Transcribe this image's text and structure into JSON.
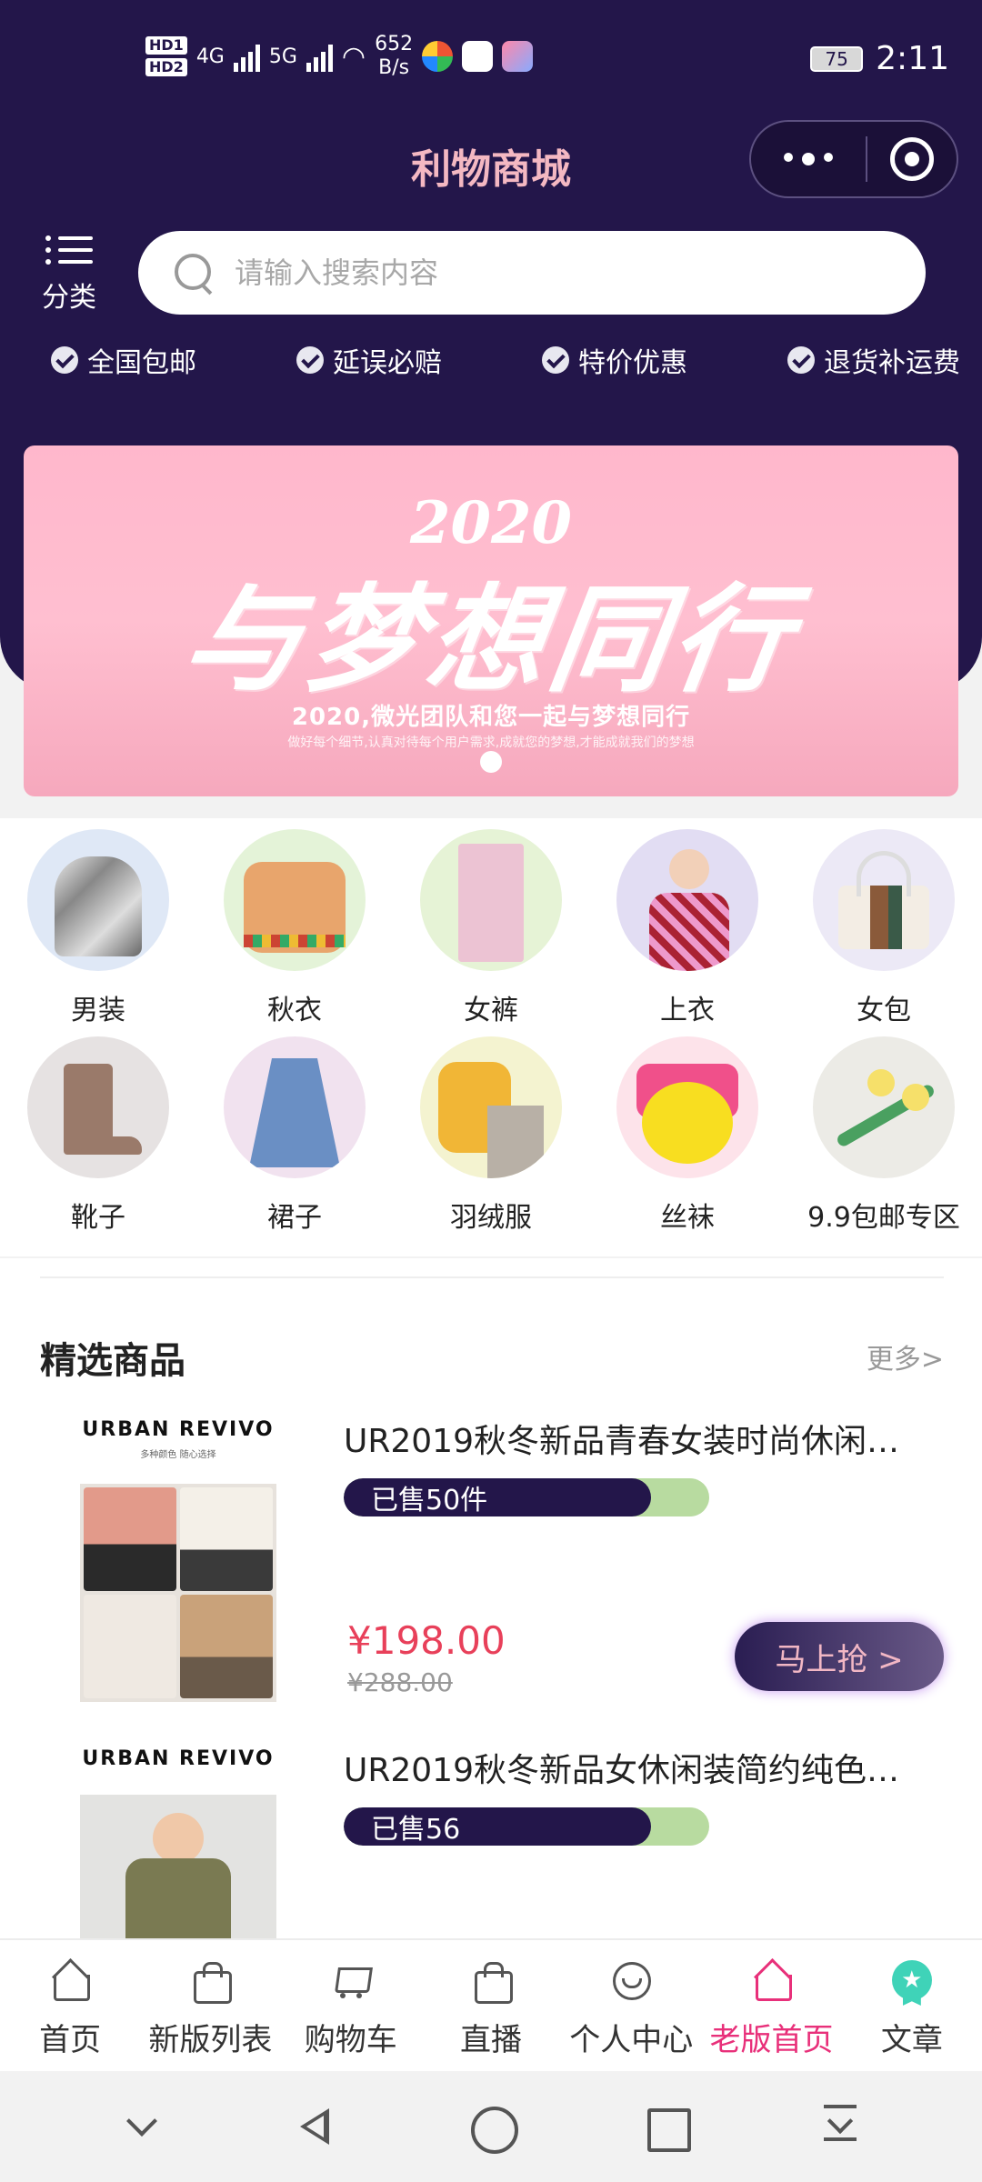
{
  "status_bar": {
    "hd1": "HD1",
    "hd2": "HD2",
    "signal1": "4G",
    "signal2": "5G",
    "net_speed": "652",
    "net_unit": "B/s",
    "battery": "75",
    "time": "2:11"
  },
  "header": {
    "title": "利物商城",
    "category_label": "分类",
    "search_placeholder": "请输入搜索内容"
  },
  "guarantees": [
    "全国包邮",
    "延误必赔",
    "特价优惠",
    "退货补运费"
  ],
  "banner": {
    "year": "2020",
    "headline": "与梦想同行",
    "subline": "2020,微光团队和您一起与梦想同行",
    "tiny_text": "做好每个细节,认真对待每个用户需求,成就您的梦想,才能成就我们的梦想"
  },
  "categories": [
    {
      "name": "男装",
      "color": "#dfe8f6"
    },
    {
      "name": "秋衣",
      "color": "#e4f3d8"
    },
    {
      "name": "女裤",
      "color": "#e6f3d6"
    },
    {
      "name": "上衣",
      "color": "#e2ddf3"
    },
    {
      "name": "女包",
      "color": "#ece9f6"
    },
    {
      "name": "靴子",
      "color": "#e6e2e2"
    },
    {
      "name": "裙子",
      "color": "#f1e2ef"
    },
    {
      "name": "羽绒服",
      "color": "#f4f3d0"
    },
    {
      "name": "丝袜",
      "color": "#fde3ea"
    },
    {
      "name": "9.9包邮专区",
      "color": "#ecebe6"
    }
  ],
  "featured": {
    "heading": "精选商品",
    "more": "更多>",
    "products": [
      {
        "brand": "URBAN REVIVO",
        "slogan": "多种颜色 随心选择",
        "title": "UR2019秋冬新品青春女装时尚休闲…",
        "sold": "已售50件",
        "sold_ratio": 0.84,
        "price": "¥198.00",
        "original_price": "¥288.00",
        "buy_label": "马上抢 >"
      },
      {
        "brand": "URBAN REVIVO",
        "slogan": "",
        "title": "UR2019秋冬新品女休闲装简约纯色…",
        "sold": "已售56",
        "sold_ratio": 0.84,
        "price": "",
        "original_price": "",
        "buy_label": ""
      }
    ]
  },
  "tabbar": [
    {
      "label": "首页",
      "icon": "home-icon",
      "active": false
    },
    {
      "label": "新版列表",
      "icon": "bag-icon",
      "active": false
    },
    {
      "label": "购物车",
      "icon": "cart-icon",
      "active": false
    },
    {
      "label": "直播",
      "icon": "bag-icon",
      "active": false
    },
    {
      "label": "个人中心",
      "icon": "face-icon",
      "active": false
    },
    {
      "label": "老版首页",
      "icon": "home-icon",
      "active": true
    },
    {
      "label": "文章",
      "icon": "badge-icon",
      "active": false
    }
  ],
  "colors": {
    "header_bg": "#23164a",
    "accent_pink": "#e8307a",
    "price_red": "#e8405a",
    "progress_green": "#b8dba0"
  }
}
